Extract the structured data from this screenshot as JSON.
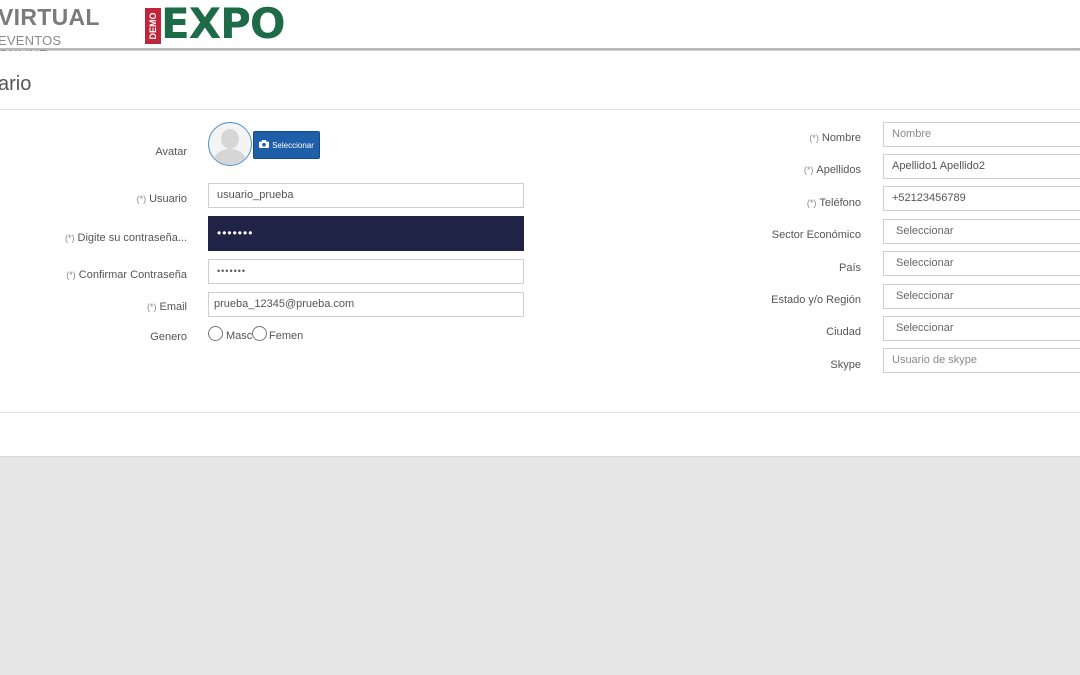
{
  "header": {
    "logo_virtual_title": "VIRTUAL",
    "logo_virtual_subtitle": "EVENTOS ONLINE",
    "logo_demo": "DEMO",
    "logo_expo": "EXPO"
  },
  "page": {
    "title": "ario"
  },
  "avatar": {
    "label": "Avatar",
    "button_label": "Seleccionar"
  },
  "left_form": {
    "usuario": {
      "label": "Usuario",
      "required": "(*)",
      "value": "usuario_prueba"
    },
    "password": {
      "label": "Digite su contraseña...",
      "required": "(*)",
      "value": "•••••••"
    },
    "confirm_password": {
      "label": "Confirmar Contraseña",
      "required": "(*)",
      "value": "•••••••"
    },
    "email": {
      "label": "Email",
      "required": "(*)",
      "value": "prueba_12345@prueba.com"
    },
    "genero": {
      "label": "Genero",
      "option_masc": "Masc",
      "option_femen": "Femen"
    }
  },
  "right_form": {
    "nombre": {
      "label": "Nombre",
      "required": "(*)",
      "placeholder": "Nombre"
    },
    "apellidos": {
      "label": "Apellidos",
      "required": "(*)",
      "value": "Apellido1 Apellido2"
    },
    "telefono": {
      "label": "Teléfono",
      "required": "(*)",
      "value": "+52123456789"
    },
    "sector": {
      "label": "Sector Económico",
      "value": "Seleccionar"
    },
    "pais": {
      "label": "País",
      "value": "Seleccionar"
    },
    "estado": {
      "label": "Estado y/o Región",
      "value": "Seleccionar"
    },
    "ciudad": {
      "label": "Ciudad",
      "value": "Seleccionar"
    },
    "skype": {
      "label": "Skype",
      "placeholder": "Usuario de skype"
    }
  },
  "colors": {
    "accent_button": "#1f5ea8",
    "active_field_bg": "#1f2447",
    "expo_green": "#1e6b48",
    "demo_red": "#c0253a"
  }
}
